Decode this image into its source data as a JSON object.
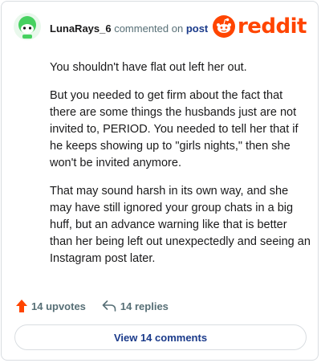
{
  "comment": {
    "username": "LunaRays_6",
    "action_text": " commented on ",
    "target_text": "post",
    "paragraphs": [
      "You shouldn't have flat out left her out.",
      "But you needed to get firm about the fact that there are some things the husbands just are not invited to, PERIOD. You needed to tell her that if he keeps showing up to \"girls nights,\" then she won't be invited anymore.",
      "That may sound harsh in its own way, and she may have still ignored your group chats in a big huff, but an advance warning like that is better than her being left out unexpectedly and seeing an Instagram post later."
    ]
  },
  "brand": {
    "logo_text": "reddit",
    "color": "#ff4500"
  },
  "actions": {
    "upvotes_label": "14 upvotes",
    "replies_label": "14 replies",
    "view_comments_label": "View 14 comments"
  },
  "colors": {
    "accent_link": "#1a3a8a",
    "muted_text": "#576f76",
    "avatar_green": "#46d160"
  }
}
